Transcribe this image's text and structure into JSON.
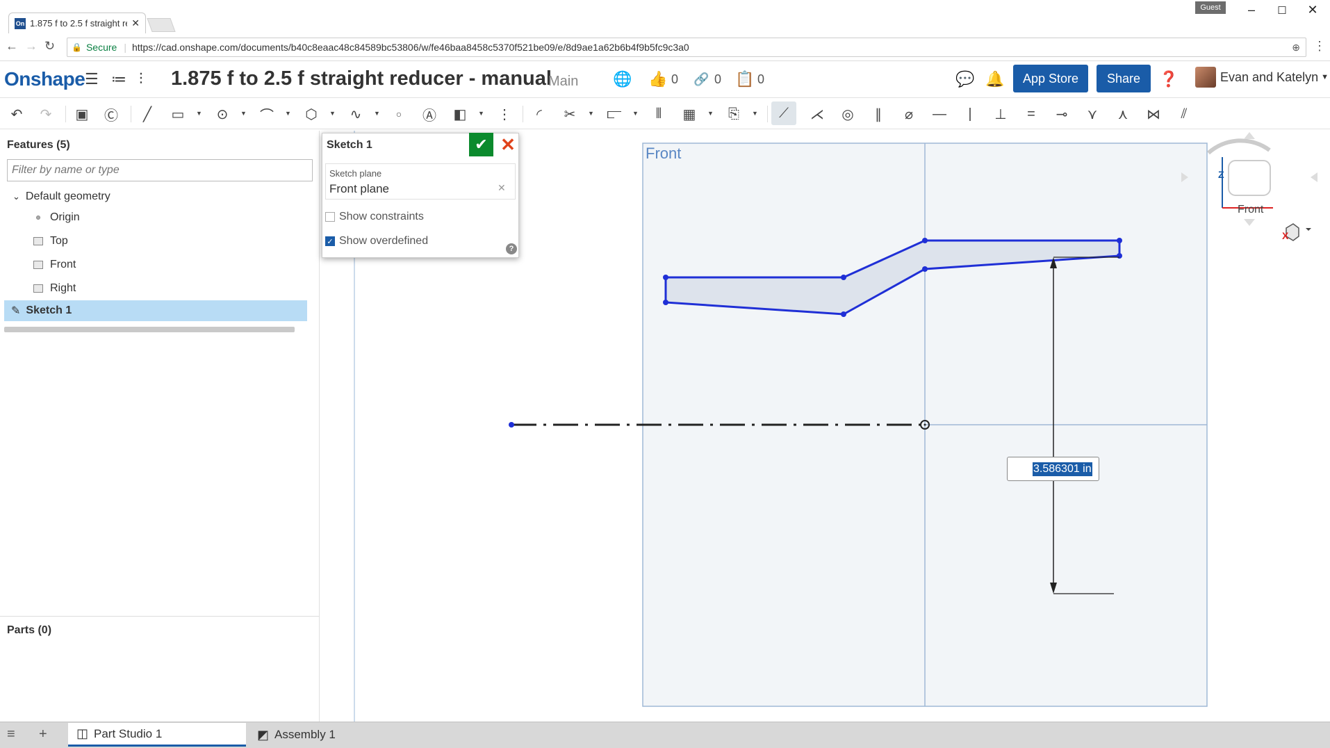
{
  "browser": {
    "tab_title": "1.875 f to 2.5 f straight re",
    "tab_favicon": "On",
    "guest_label": "Guest",
    "secure_label": "Secure",
    "url": "https://cad.onshape.com/documents/b40c8eaac48c84589bc53806/w/fe46baa8458c5370f521be09/e/8d9ae1a62b6b4f9b5fc9c3a0"
  },
  "header": {
    "logo": "Onshape",
    "document_title": "1.875 f to 2.5 f straight reducer - manual",
    "branch": "Main",
    "likes": "0",
    "links": "0",
    "copies": "0",
    "app_store_label": "App Store",
    "share_label": "Share",
    "user_name": "Evan and Katelyn"
  },
  "features": {
    "heading": "Features (5)",
    "filter_placeholder": "Filter by name or type",
    "group_label": "Default geometry",
    "items": [
      "Origin",
      "Top",
      "Front",
      "Right"
    ],
    "selected_sketch": "Sketch 1",
    "parts_heading": "Parts (0)"
  },
  "sketch_dialog": {
    "title": "Sketch 1",
    "plane_label": "Sketch plane",
    "plane_value": "Front plane",
    "show_constraints_label": "Show constraints",
    "show_constraints_checked": false,
    "show_overdefined_label": "Show overdefined",
    "show_overdefined_checked": true
  },
  "canvas": {
    "view_label": "Front",
    "dimension_value": "3.586301 in",
    "viewcube_label": "Front",
    "axis_z": "Z",
    "axis_x": "X"
  },
  "bottom_tabs": [
    {
      "label": "Part Studio 1",
      "active": true
    },
    {
      "label": "Assembly 1",
      "active": false
    }
  ],
  "colors": {
    "brand": "#1a5ca8",
    "sketch_line": "#1f2fd6",
    "selection": "#b8dcf5",
    "ok_green": "#0b8a2d",
    "cancel_red": "#e0431b"
  }
}
